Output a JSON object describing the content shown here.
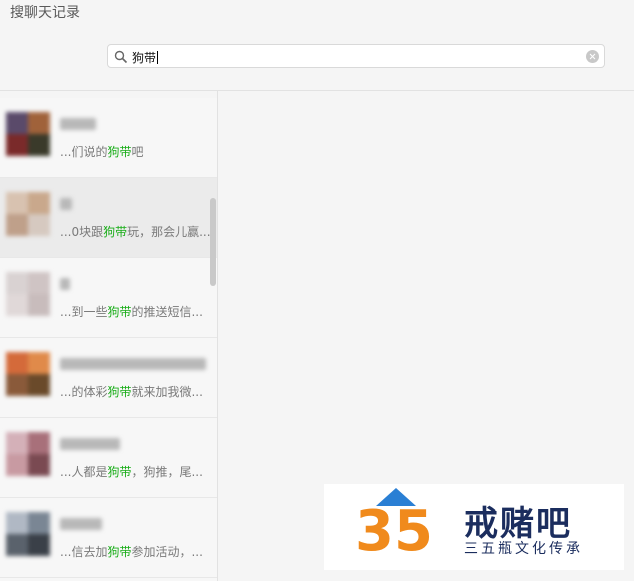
{
  "window": {
    "title": "搜聊天记录"
  },
  "search": {
    "value": "狗带"
  },
  "results": [
    {
      "pre": "...们说的",
      "hl": "狗带",
      "post": "吧"
    },
    {
      "pre": "...0块跟",
      "hl": "狗带",
      "post": "玩，那会儿赢..."
    },
    {
      "pre": "...到一些",
      "hl": "狗带",
      "post": "的推送短信..."
    },
    {
      "pre": "...的体彩",
      "hl": "狗带",
      "post": "就来加我微..."
    },
    {
      "pre": "...人都是",
      "hl": "狗带",
      "post": "，狗推，尾..."
    },
    {
      "pre": "...信去加",
      "hl": "狗带",
      "post": "参加活动，..."
    }
  ],
  "watermark": {
    "number": "35",
    "brand": "戒赌吧",
    "sub": "三五瓶文化传承"
  },
  "colors": {
    "highlight": "#1aad19",
    "selected_row": "#ebebeb",
    "brand_navy": "#1b2d5e",
    "brand_orange": "#f08a1c",
    "brand_blue": "#2a7fd4"
  }
}
